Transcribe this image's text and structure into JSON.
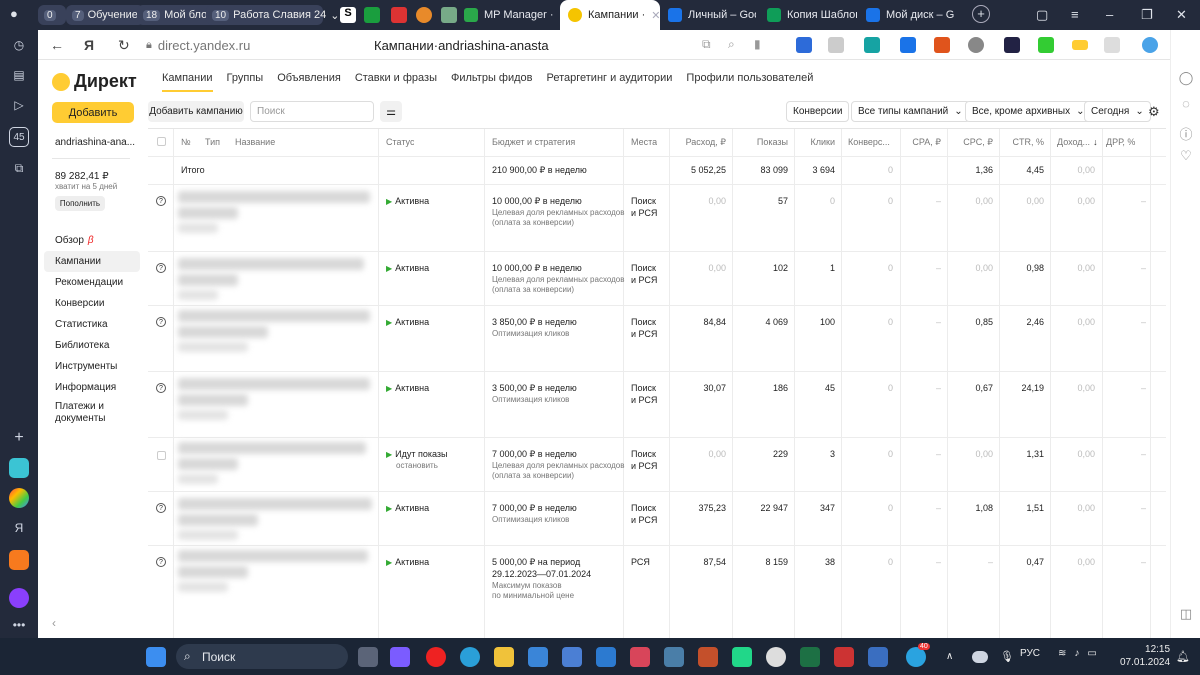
{
  "browser": {
    "tab_pills": [
      {
        "count": "0",
        "label": ""
      },
      {
        "count": "7",
        "label": "Обучение"
      },
      {
        "count": "18",
        "label": "Мой блог"
      },
      {
        "count": "10",
        "label": "Работа Славия 24"
      }
    ],
    "tabs": [
      {
        "label": "MP Manager ·",
        "color": "#2aa84a"
      },
      {
        "label": "Кампании ·",
        "color": "#f5c400"
      },
      {
        "label": "Личный – Goo",
        "color": "#1a73e8"
      },
      {
        "label": "Копия Шаблон",
        "color": "#0f9d58"
      },
      {
        "label": "Мой диск – G",
        "color": "#1a73e8"
      }
    ],
    "url": "direct.yandex.ru",
    "page_title": "Кампании",
    "page_title_account": "andriashina-anasta",
    "left_badge": "45"
  },
  "app": {
    "logo": "Директ",
    "tabs": [
      "Кампании",
      "Группы",
      "Объявления",
      "Ставки и фразы",
      "Фильтры фидов",
      "Ретаргетинг и аудитории",
      "Профили пользователей"
    ],
    "add_button": "Добавить",
    "account": "andriashina-ana...",
    "balance": "89 282,41 ₽",
    "balance_note": "хватит на 5 дней",
    "topup": "Пополнить",
    "nav": [
      "Обзор",
      "Кампании",
      "Рекомендации",
      "Конверсии",
      "Статистика",
      "Библиотека",
      "Инструменты",
      "Информация",
      "Платежи и документы"
    ],
    "beta": "β"
  },
  "toolbar": {
    "add_campaign": "Добавить кампанию",
    "search_placeholder": "Поиск",
    "conversions": "Конверсии",
    "types": "Все типы кампаний",
    "archive": "Все, кроме архивных",
    "period": "Сегодня"
  },
  "table": {
    "headers": [
      "№",
      "Тип",
      "Название",
      "Статус",
      "Бюджет и стратегия",
      "Места",
      "Расход, ₽",
      "Показы",
      "Клики",
      "Конверс...",
      "CPA, ₽",
      "CPC, ₽",
      "CTR, %",
      "Доход...",
      "ДРР, %"
    ],
    "sort_arrow": "↓",
    "total": {
      "label": "Итого",
      "budget": "210 900,00 ₽ в неделю",
      "spend": "5 052,25",
      "impressions": "83 099",
      "clicks": "3 694",
      "conversions": "0",
      "cpc": "1,36",
      "ctr": "4,45",
      "income": "0,00"
    },
    "rows": [
      {
        "status": "Активна",
        "status_sub": "",
        "budget": "10 000,00 ₽ в неделю",
        "strategy": [
          "Целевая доля рекламных расходов",
          "(оплата за конверсии)"
        ],
        "places": [
          "Поиск",
          "и РСЯ"
        ],
        "spend": "0,00",
        "impressions": "57",
        "clicks": "0",
        "conversions": "0",
        "cpa": "–",
        "cpc": "0,00",
        "ctr": "0,00",
        "income": "0,00",
        "drr": "–"
      },
      {
        "status": "Активна",
        "status_sub": "",
        "budget": "10 000,00 ₽ в неделю",
        "strategy": [
          "Целевая доля рекламных расходов",
          "(оплата за конверсии)"
        ],
        "places": [
          "Поиск",
          "и РСЯ"
        ],
        "spend": "0,00",
        "impressions": "102",
        "clicks": "1",
        "conversions": "0",
        "cpa": "–",
        "cpc": "0,00",
        "ctr": "0,98",
        "income": "0,00",
        "drr": "–"
      },
      {
        "status": "Активна",
        "status_sub": "",
        "budget": "3 850,00 ₽ в неделю",
        "strategy": [
          "Оптимизация кликов",
          ""
        ],
        "places": [
          "Поиск",
          "и РСЯ"
        ],
        "spend": "84,84",
        "impressions": "4 069",
        "clicks": "100",
        "conversions": "0",
        "cpa": "–",
        "cpc": "0,85",
        "ctr": "2,46",
        "income": "0,00",
        "drr": "–"
      },
      {
        "status": "Активна",
        "status_sub": "",
        "budget": "3 500,00 ₽ в неделю",
        "strategy": [
          "Оптимизация кликов",
          ""
        ],
        "places": [
          "Поиск",
          "и РСЯ"
        ],
        "spend": "30,07",
        "impressions": "186",
        "clicks": "45",
        "conversions": "0",
        "cpa": "–",
        "cpc": "0,67",
        "ctr": "24,19",
        "income": "0,00",
        "drr": "–"
      },
      {
        "status": "Идут показы",
        "status_sub": "остановить",
        "budget": "7 000,00 ₽ в неделю",
        "strategy": [
          "Целевая доля рекламных расходов",
          "(оплата за конверсии)"
        ],
        "places": [
          "Поиск",
          "и РСЯ"
        ],
        "spend": "0,00",
        "impressions": "229",
        "clicks": "3",
        "conversions": "0",
        "cpa": "–",
        "cpc": "0,00",
        "ctr": "1,31",
        "income": "0,00",
        "drr": "–"
      },
      {
        "status": "Активна",
        "status_sub": "",
        "budget": "7 000,00 ₽ в неделю",
        "strategy": [
          "Оптимизация кликов",
          ""
        ],
        "places": [
          "Поиск",
          "и РСЯ"
        ],
        "spend": "375,23",
        "impressions": "22 947",
        "clicks": "347",
        "conversions": "0",
        "cpa": "–",
        "cpc": "1,08",
        "ctr": "1,51",
        "income": "0,00",
        "drr": "–"
      },
      {
        "status": "Активна",
        "status_sub": "",
        "budget": "5 000,00 ₽ на период",
        "budget2": "29.12.2023—07.01.2024",
        "strategy": [
          "Максимум показов",
          "по минимальной цене"
        ],
        "places": [
          "РСЯ",
          ""
        ],
        "spend": "87,54",
        "impressions": "8 159",
        "clicks": "38",
        "conversions": "0",
        "cpa": "–",
        "cpc": "–",
        "ctr": "0,47",
        "income": "0,00",
        "drr": "–"
      }
    ]
  },
  "taskbar": {
    "search": "Поиск",
    "lang": "РУС",
    "time": "12:15",
    "date": "07.01.2024",
    "badge": "40"
  }
}
